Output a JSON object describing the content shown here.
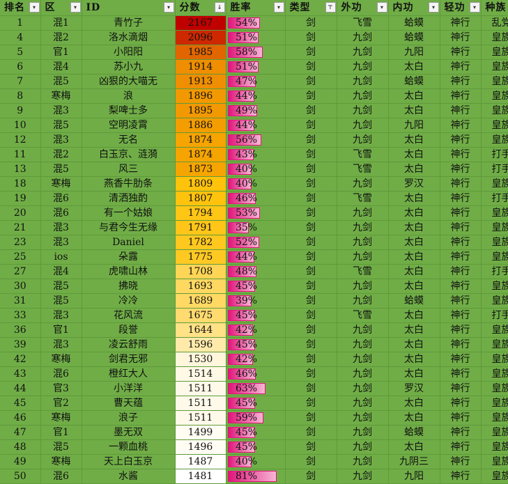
{
  "headers": [
    {
      "label": "排名",
      "filter": "▾"
    },
    {
      "label": "区",
      "filter": "▾"
    },
    {
      "label": "ID",
      "filter": "▾"
    },
    {
      "label": "分数",
      "filter": "↓"
    },
    {
      "label": "胜率",
      "filter": "▾"
    },
    {
      "label": "类型",
      "filter": "⊤"
    },
    {
      "label": "外功",
      "filter": "▾"
    },
    {
      "label": "内功",
      "filter": "▾"
    },
    {
      "label": "轻功",
      "filter": "▾"
    },
    {
      "label": "种族",
      "filter": "▾"
    }
  ],
  "rows": [
    {
      "rank": "1",
      "zone": "混1",
      "id": "青竹子",
      "score": "2167",
      "winrate": "54%",
      "type": "剑",
      "outer": "飞雪",
      "inner": "蛤蟆",
      "light": "神行",
      "race": "乱党"
    },
    {
      "rank": "4",
      "zone": "混2",
      "id": "洛水滴烟",
      "score": "2096",
      "winrate": "51%",
      "type": "剑",
      "outer": "九剑",
      "inner": "蛤蟆",
      "light": "神行",
      "race": "皇族"
    },
    {
      "rank": "5",
      "zone": "官1",
      "id": "小阳阳",
      "score": "1985",
      "winrate": "58%",
      "type": "剑",
      "outer": "九剑",
      "inner": "九阳",
      "light": "神行",
      "race": "皇族"
    },
    {
      "rank": "6",
      "zone": "混4",
      "id": "苏小九",
      "score": "1914",
      "winrate": "51%",
      "type": "剑",
      "outer": "九剑",
      "inner": "太白",
      "light": "神行",
      "race": "皇族"
    },
    {
      "rank": "7",
      "zone": "混5",
      "id": "凶狠的大喵无",
      "score": "1913",
      "winrate": "47%",
      "type": "剑",
      "outer": "九剑",
      "inner": "蛤蟆",
      "light": "神行",
      "race": "皇族"
    },
    {
      "rank": "8",
      "zone": "寒梅",
      "id": "浪",
      "score": "1896",
      "winrate": "44%",
      "type": "剑",
      "outer": "九剑",
      "inner": "太白",
      "light": "神行",
      "race": "皇族"
    },
    {
      "rank": "9",
      "zone": "混3",
      "id": "梨啤士多",
      "score": "1895",
      "winrate": "49%",
      "type": "剑",
      "outer": "九剑",
      "inner": "太白",
      "light": "神行",
      "race": "皇族"
    },
    {
      "rank": "10",
      "zone": "混5",
      "id": "空明凌霄",
      "score": "1886",
      "winrate": "44%",
      "type": "剑",
      "outer": "九剑",
      "inner": "九阳",
      "light": "神行",
      "race": "皇族"
    },
    {
      "rank": "12",
      "zone": "混3",
      "id": "无名",
      "score": "1874",
      "winrate": "56%",
      "type": "剑",
      "outer": "九剑",
      "inner": "太白",
      "light": "神行",
      "race": "皇族"
    },
    {
      "rank": "11",
      "zone": "混2",
      "id": "白玉京、涟漪",
      "score": "1874",
      "winrate": "43%",
      "type": "剑",
      "outer": "飞雪",
      "inner": "太白",
      "light": "神行",
      "race": "打手"
    },
    {
      "rank": "13",
      "zone": "混5",
      "id": "风三",
      "score": "1873",
      "winrate": "40%",
      "type": "剑",
      "outer": "飞雪",
      "inner": "太白",
      "light": "神行",
      "race": "打手"
    },
    {
      "rank": "18",
      "zone": "寒梅",
      "id": "燕香牛肋条",
      "score": "1809",
      "winrate": "40%",
      "type": "剑",
      "outer": "九剑",
      "inner": "罗汉",
      "light": "神行",
      "race": "皇族"
    },
    {
      "rank": "19",
      "zone": "混6",
      "id": "清洒独酌",
      "score": "1807",
      "winrate": "46%",
      "type": "剑",
      "outer": "飞雪",
      "inner": "太白",
      "light": "神行",
      "race": "打手"
    },
    {
      "rank": "20",
      "zone": "混6",
      "id": "有一个姑娘",
      "score": "1794",
      "winrate": "53%",
      "type": "剑",
      "outer": "九剑",
      "inner": "太白",
      "light": "神行",
      "race": "皇族"
    },
    {
      "rank": "21",
      "zone": "混3",
      "id": "与君今生无缘",
      "score": "1791",
      "winrate": "35%",
      "type": "剑",
      "outer": "九剑",
      "inner": "太白",
      "light": "神行",
      "race": "皇族"
    },
    {
      "rank": "23",
      "zone": "混3",
      "id": "Daniel",
      "score": "1782",
      "winrate": "52%",
      "type": "剑",
      "outer": "九剑",
      "inner": "太白",
      "light": "神行",
      "race": "皇族"
    },
    {
      "rank": "25",
      "zone": "ios",
      "id": "朵露",
      "score": "1775",
      "winrate": "44%",
      "type": "剑",
      "outer": "九剑",
      "inner": "太白",
      "light": "神行",
      "race": "皇族"
    },
    {
      "rank": "27",
      "zone": "混4",
      "id": "虎啸山林",
      "score": "1708",
      "winrate": "48%",
      "type": "剑",
      "outer": "飞雪",
      "inner": "太白",
      "light": "神行",
      "race": "打手"
    },
    {
      "rank": "30",
      "zone": "混5",
      "id": "拂晓",
      "score": "1693",
      "winrate": "45%",
      "type": "剑",
      "outer": "九剑",
      "inner": "太白",
      "light": "神行",
      "race": "皇族"
    },
    {
      "rank": "31",
      "zone": "混5",
      "id": "冷冷",
      "score": "1689",
      "winrate": "39%",
      "type": "剑",
      "outer": "九剑",
      "inner": "蛤蟆",
      "light": "神行",
      "race": "皇族"
    },
    {
      "rank": "33",
      "zone": "混3",
      "id": "花风流",
      "score": "1675",
      "winrate": "45%",
      "type": "剑",
      "outer": "飞雪",
      "inner": "太白",
      "light": "神行",
      "race": "打手"
    },
    {
      "rank": "36",
      "zone": "官1",
      "id": "段誉",
      "score": "1644",
      "winrate": "42%",
      "type": "剑",
      "outer": "九剑",
      "inner": "太白",
      "light": "神行",
      "race": "皇族"
    },
    {
      "rank": "39",
      "zone": "混3",
      "id": "凌云舒雨",
      "score": "1596",
      "winrate": "45%",
      "type": "剑",
      "outer": "九剑",
      "inner": "太白",
      "light": "神行",
      "race": "皇族"
    },
    {
      "rank": "42",
      "zone": "寒梅",
      "id": "剑君无邪",
      "score": "1530",
      "winrate": "42%",
      "type": "剑",
      "outer": "九剑",
      "inner": "太白",
      "light": "神行",
      "race": "皇族"
    },
    {
      "rank": "43",
      "zone": "混6",
      "id": "橙红大人",
      "score": "1514",
      "winrate": "46%",
      "type": "剑",
      "outer": "九剑",
      "inner": "太白",
      "light": "神行",
      "race": "皇族"
    },
    {
      "rank": "44",
      "zone": "官3",
      "id": "小洋洋",
      "score": "1511",
      "winrate": "63%",
      "type": "剑",
      "outer": "九剑",
      "inner": "罗汉",
      "light": "神行",
      "race": "皇族"
    },
    {
      "rank": "45",
      "zone": "官2",
      "id": "曹天蕴",
      "score": "1511",
      "winrate": "45%",
      "type": "剑",
      "outer": "九剑",
      "inner": "太白",
      "light": "神行",
      "race": "皇族"
    },
    {
      "rank": "46",
      "zone": "寒梅",
      "id": "浪子",
      "score": "1511",
      "winrate": "59%",
      "type": "剑",
      "outer": "九剑",
      "inner": "太白",
      "light": "神行",
      "race": "皇族"
    },
    {
      "rank": "47",
      "zone": "官1",
      "id": "墨无双",
      "score": "1499",
      "winrate": "45%",
      "type": "剑",
      "outer": "九剑",
      "inner": "蛤蟆",
      "light": "神行",
      "race": "皇族"
    },
    {
      "rank": "48",
      "zone": "混5",
      "id": "一颗血桃",
      "score": "1496",
      "winrate": "45%",
      "type": "剑",
      "outer": "九剑",
      "inner": "太白",
      "light": "神行",
      "race": "皇族"
    },
    {
      "rank": "49",
      "zone": "寒梅",
      "id": "天上白玉京",
      "score": "1487",
      "winrate": "40%",
      "type": "剑",
      "outer": "九剑",
      "inner": "九阴三",
      "light": "神行",
      "race": "皇族"
    },
    {
      "rank": "50",
      "zone": "混6",
      "id": "水酱",
      "score": "1481",
      "winrate": "81%",
      "type": "剑",
      "outer": "九剑",
      "inner": "九阳",
      "light": "神行",
      "race": "皇族"
    }
  ],
  "colors": {
    "background": "#70ad47",
    "score_high": "#c00000",
    "score_mid": "#ffc000",
    "score_low": "#ffffff",
    "winrate_bar": "#e0157a"
  }
}
